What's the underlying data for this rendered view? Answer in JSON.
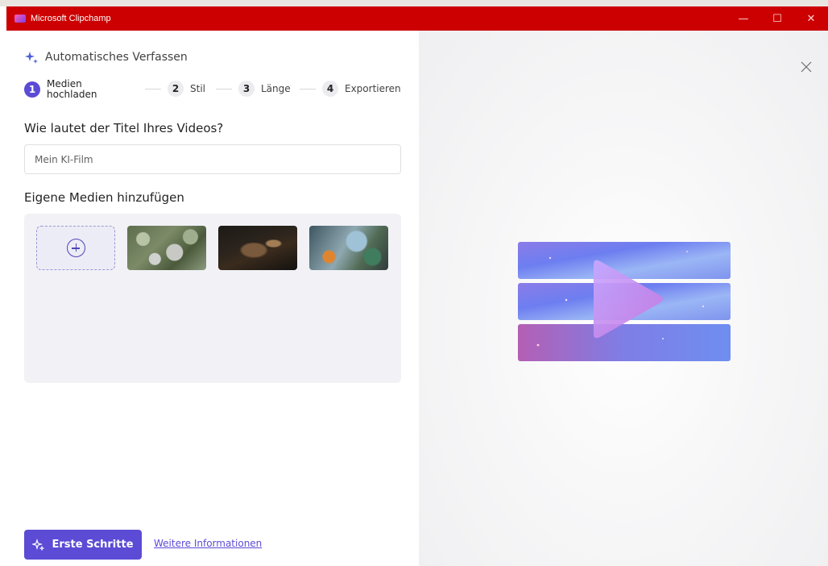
{
  "window": {
    "title": "Microsoft Clipchamp",
    "minimize": "—",
    "maximize": "☐",
    "close": "✕"
  },
  "header": {
    "title": "Automatisches Verfassen"
  },
  "stepper": {
    "steps": [
      {
        "number": "1",
        "label_line1": "Medien",
        "label_line2": "hochladen",
        "active": true
      },
      {
        "number": "2",
        "label": "Stil",
        "active": false
      },
      {
        "number": "3",
        "label": "Länge",
        "active": false
      },
      {
        "number": "4",
        "label": "Exportieren",
        "active": false
      }
    ]
  },
  "title_section": {
    "heading": "Wie lautet der Titel Ihres Videos?",
    "input_value": "Mein KI-Film"
  },
  "media_section": {
    "heading": "Eigene Medien hinzufügen",
    "thumbnails": [
      "aerial-village-thumbnail",
      "dark-interior-thumbnail",
      "outdoor-rides-thumbnail"
    ]
  },
  "footer": {
    "primary_button": "Erste Schritte",
    "link": "Weitere Informationen"
  },
  "colors": {
    "titlebar": "#cc0000",
    "accent": "#5b4bd5"
  }
}
